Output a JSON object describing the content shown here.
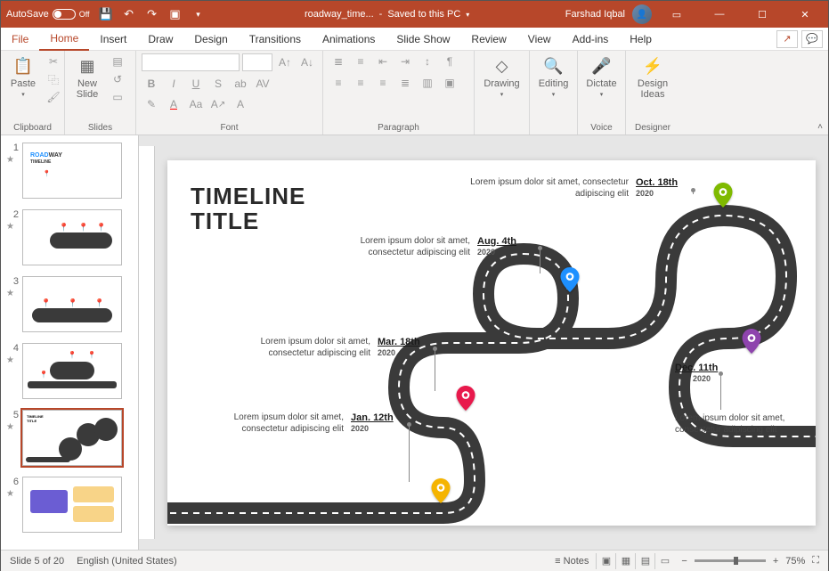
{
  "titlebar": {
    "autosave": "AutoSave",
    "autosave_state": "Off",
    "filename": "roadway_time...",
    "save_state": "Saved to this PC",
    "user": "Farshad Iqbal"
  },
  "tabs": {
    "file": "File",
    "home": "Home",
    "insert": "Insert",
    "draw": "Draw",
    "design": "Design",
    "transitions": "Transitions",
    "animations": "Animations",
    "slideshow": "Slide Show",
    "review": "Review",
    "view": "View",
    "addins": "Add-ins",
    "help": "Help"
  },
  "ribbon": {
    "clipboard": "Clipboard",
    "paste": "Paste",
    "slides": "Slides",
    "newslide": "New\nSlide",
    "font": "Font",
    "paragraph": "Paragraph",
    "drawing": "Drawing",
    "editing": "Editing",
    "dictate": "Dictate",
    "voice": "Voice",
    "designer": "Designer",
    "design_ideas": "Design\nIdeas"
  },
  "thumbs": [
    "1",
    "2",
    "3",
    "4",
    "5",
    "6"
  ],
  "slide": {
    "title": "TIMELINE\nTITLE",
    "milestones": [
      {
        "date": "Jan. 12th",
        "year": "2020",
        "desc": "Lorem ipsum dolor sit amet, consectetur adipiscing elit"
      },
      {
        "date": "Mar. 18th",
        "year": "2020",
        "desc": "Lorem ipsum dolor sit amet, consectetur adipiscing elit"
      },
      {
        "date": "Aug. 4th",
        "year": "2020",
        "desc": "Lorem ipsum dolor sit amet, consectetur adipiscing elit"
      },
      {
        "date": "Oct. 18th",
        "year": "2020",
        "desc": "Lorem ipsum dolor sit amet, consectetur adipiscing elit"
      },
      {
        "date": "Dec. 11th",
        "year": "2020",
        "desc": "Lorem ipsum dolor sit amet, consectetur adipiscing elit"
      }
    ]
  },
  "status": {
    "slide_info": "Slide 5 of 20",
    "language": "English (United States)",
    "notes": "Notes",
    "zoom": "75%"
  }
}
